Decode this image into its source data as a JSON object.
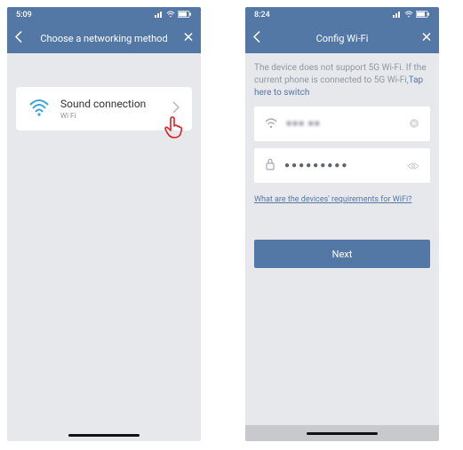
{
  "left": {
    "status_time": "5:09",
    "status_signal": "▮▮▮▮",
    "nav_title": "Choose a networking method",
    "card": {
      "title": "Sound connection",
      "subtitle": "Wi Fi"
    }
  },
  "right": {
    "status_time": "8:24",
    "status_signal": "▮▮▮▮",
    "nav_title": "Config Wi-Fi",
    "info_prefix": "The device does not support 5G Wi-Fi. If the current phone is connected to 5G Wi-Fi,",
    "info_link": "Tap here to switch",
    "wifi_name": "■■■ ■■",
    "password_mask": "●●●●●●●●●",
    "faq_link": "What are the devices' requirements for WiFi?",
    "next_label": "Next"
  },
  "icons": {
    "back": "back-icon",
    "close": "close-icon",
    "wifi": "wifi-icon",
    "chevron": "chevron-right-icon",
    "pointer": "hand-pointer-icon",
    "lock": "lock-icon",
    "clear": "clear-icon",
    "eye": "eye-icon",
    "signal": "signal-icon",
    "battery": "battery-icon"
  },
  "colors": {
    "header": "#5478a5",
    "bg": "#e6e8ec",
    "pointer": "#e02020"
  }
}
